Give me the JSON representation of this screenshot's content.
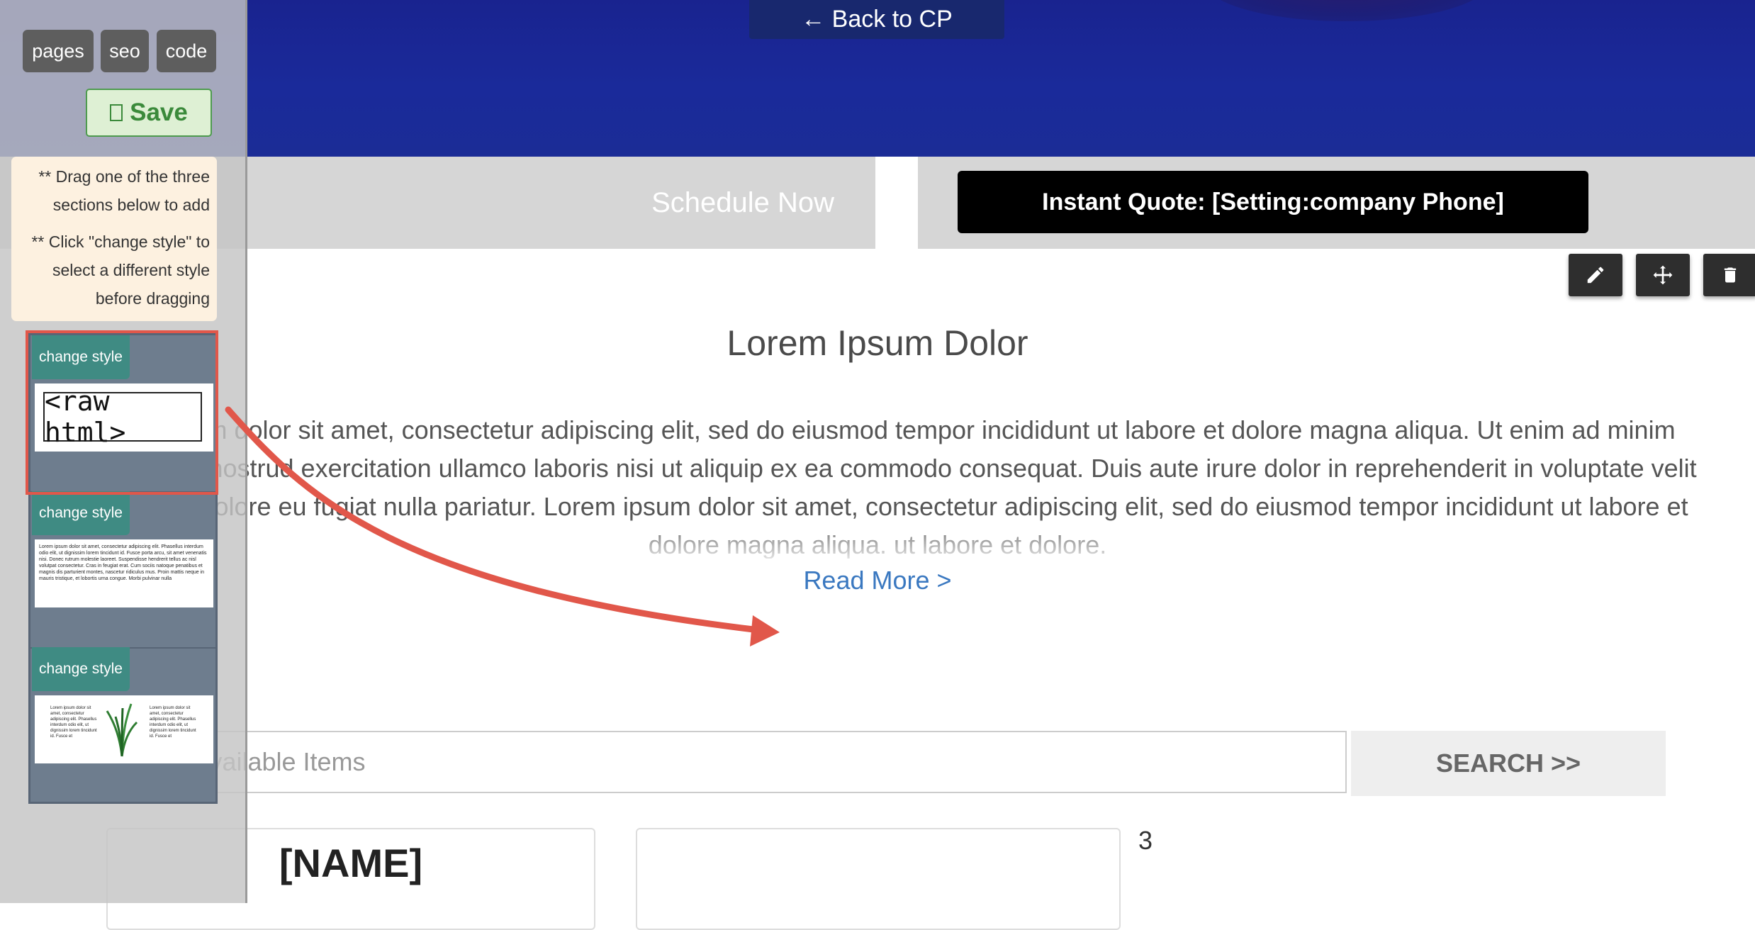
{
  "toolbar": {
    "back_label": "← Back to CP",
    "pages_label": "pages",
    "seo_label": "seo",
    "code_label": "code",
    "save_label": "Save"
  },
  "sidebar": {
    "help": [
      "** Drag one of the three sections below to add",
      "** Click \"change style\" to select a different style before dragging"
    ],
    "templates": [
      {
        "change_style_label": "change style",
        "preview": "<raw html>"
      },
      {
        "change_style_label": "change style",
        "preview": "Lorem ipsum dolor sit amet, consectetur adipiscing elit. Phasellus interdum odio elit, ut dignissim lorem tincidunt id. Fusce porta arcu, sit amet venenatis nisi. Donec rutrum molestie laoreet. Suspendisse hendrerit tellus ac nisl volutpat consectetur. Cras in feugiat erat. Cum sociis natoque penatibus et magnis dis parturient montes, nascetur ridiculus mus. Proin mattis neque in mauris tristique, et lobortis urna congue. Morbi pulvinar nulla"
      },
      {
        "change_style_label": "change style",
        "preview_left": "Lorem ipsum dolor sit amet, consectetur adipiscing elit. Phasellus interdum odio elit, ut dignissim lorem tincidunt id. Fusce et",
        "preview_right": "Lorem ipsum dolor sit amet, consectetur adipiscing elit. Phasellus interdum odio elit, ut dignissim lorem tincidunt id. Fusce et"
      }
    ]
  },
  "cta": {
    "schedule_label": "Schedule Now",
    "quote_label": "Instant Quote: [Setting:company Phone]"
  },
  "content": {
    "title": "Lorem Ipsum Dolor",
    "body": "Lorem ipsum dolor sit amet, consectetur adipiscing elit, sed do eiusmod tempor incididunt ut labore et dolore magna aliqua. Ut enim ad minim veniam, quis nostrud exercitation ullamco laboris nisi ut aliquip ex ea commodo consequat. Duis aute irure dolor in reprehenderit in voluptate velit esse cillum dolore eu fugiat nulla pariatur. Lorem ipsum dolor sit amet, consectetur adipiscing elit, sed do eiusmod tempor incididunt ut labore et dolore magna aliqua. ut labore et dolore.",
    "read_more": "Read More >"
  },
  "search": {
    "placeholder": "Search Available Items",
    "button_label": "SEARCH >>"
  },
  "listing": {
    "card_name": "[NAME]",
    "count": "3"
  },
  "colors": {
    "hero": "#1a2a9a",
    "change_style": "#3f8b83",
    "save_green": "#3b8a3b",
    "annotation_red": "#e1574a",
    "link_blue": "#3a78c0"
  }
}
